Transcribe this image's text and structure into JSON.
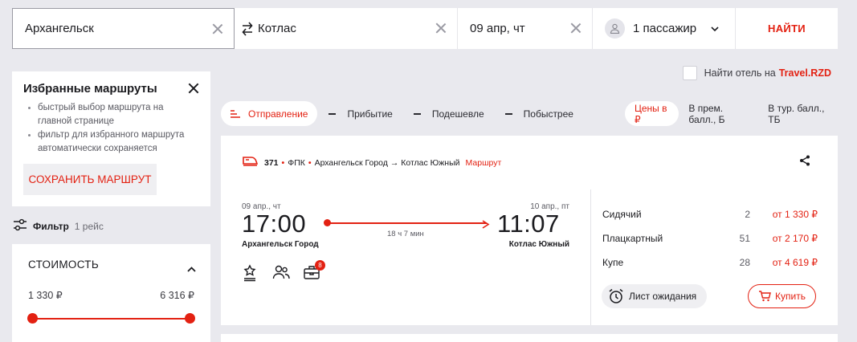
{
  "search": {
    "from": "Архангельск",
    "to": "Котлас",
    "date": "09 апр, чт",
    "passengers": "1 пассажир",
    "find_label": "НАЙТИ"
  },
  "hotel": {
    "label": "Найти отель на",
    "brand": "Travel.RZD"
  },
  "favorites": {
    "title": "Избранные маршруты",
    "items": [
      "быстрый выбор маршрута на главной странице",
      "фильтр для избранного маршрута автоматически сохраняется"
    ],
    "save_label": "СОХРАНИТЬ МАРШРУТ"
  },
  "filter": {
    "label": "Фильтр",
    "count": "1 рейс"
  },
  "cost": {
    "title": "СТОИМОСТЬ",
    "min": "1 330 ₽",
    "max": "6 316 ₽"
  },
  "sort": {
    "tabs": [
      "Отправление",
      "Прибытие",
      "Подешевле",
      "Побыстрее"
    ],
    "price_tabs": [
      "Цены в ₽",
      "В прем. балл., Б",
      "В тур. балл., ТБ"
    ]
  },
  "train": {
    "number": "371",
    "carrier": "ФПК",
    "route": "Архангельск Город → Котлас Южный",
    "route_link": "Маршрут",
    "dep_date": "09 апр., чт",
    "arr_date": "10 апр., пт",
    "dep_time": "17:00",
    "arr_time": "11:07",
    "duration": "18 ч 7 мин",
    "dep_station": "Архангельск Город",
    "arr_station": "Котлас Южный",
    "feature_badge": "8",
    "classes": [
      {
        "name": "Сидячий",
        "seats": "2",
        "price": "от 1 330 ₽"
      },
      {
        "name": "Плацкартный",
        "seats": "51",
        "price": "от 2 170 ₽"
      },
      {
        "name": "Купе",
        "seats": "28",
        "price": "от 4 619 ₽"
      }
    ],
    "wait_label": "Лист ожидания",
    "buy_label": "Купить"
  },
  "colors": {
    "accent": "#e32112",
    "background": "#e9e9ee"
  }
}
